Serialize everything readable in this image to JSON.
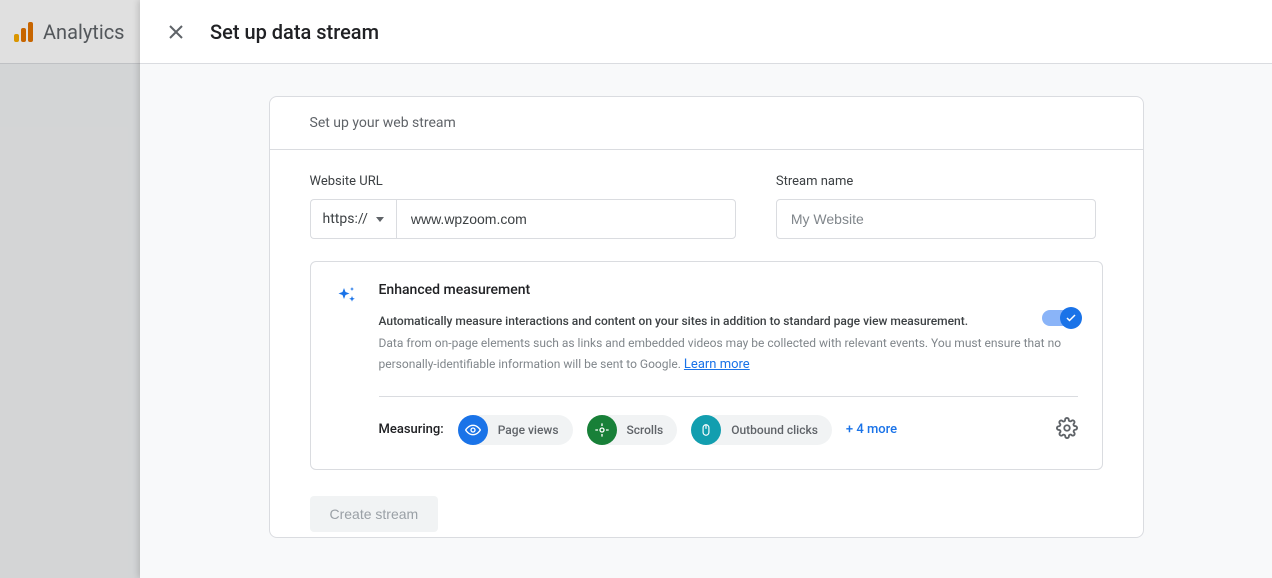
{
  "backdrop": {
    "app_name": "Analytics"
  },
  "panel": {
    "title": "Set up data stream"
  },
  "card": {
    "header": "Set up your web stream",
    "website_url_label": "Website URL",
    "stream_name_label": "Stream name",
    "protocol": "https://",
    "url_value": "www.wpzoom.com",
    "name_placeholder": "My Website",
    "name_value": ""
  },
  "enhanced": {
    "title": "Enhanced measurement",
    "description": "Automatically measure interactions and content on your sites in addition to standard page view measurement.",
    "note": "Data from on-page elements such as links and embedded videos may be collected with relevant events. You must ensure that no personally-identifiable information will be sent to Google.",
    "learn_more": "Learn more",
    "toggle_on": true
  },
  "measuring": {
    "label": "Measuring:",
    "chips": [
      {
        "label": "Page views",
        "icon": "eye",
        "color": "blue"
      },
      {
        "label": "Scrolls",
        "icon": "target",
        "color": "green"
      },
      {
        "label": "Outbound clicks",
        "icon": "mouse",
        "color": "teal"
      }
    ],
    "more": "+ 4 more"
  },
  "actions": {
    "create": "Create stream"
  }
}
